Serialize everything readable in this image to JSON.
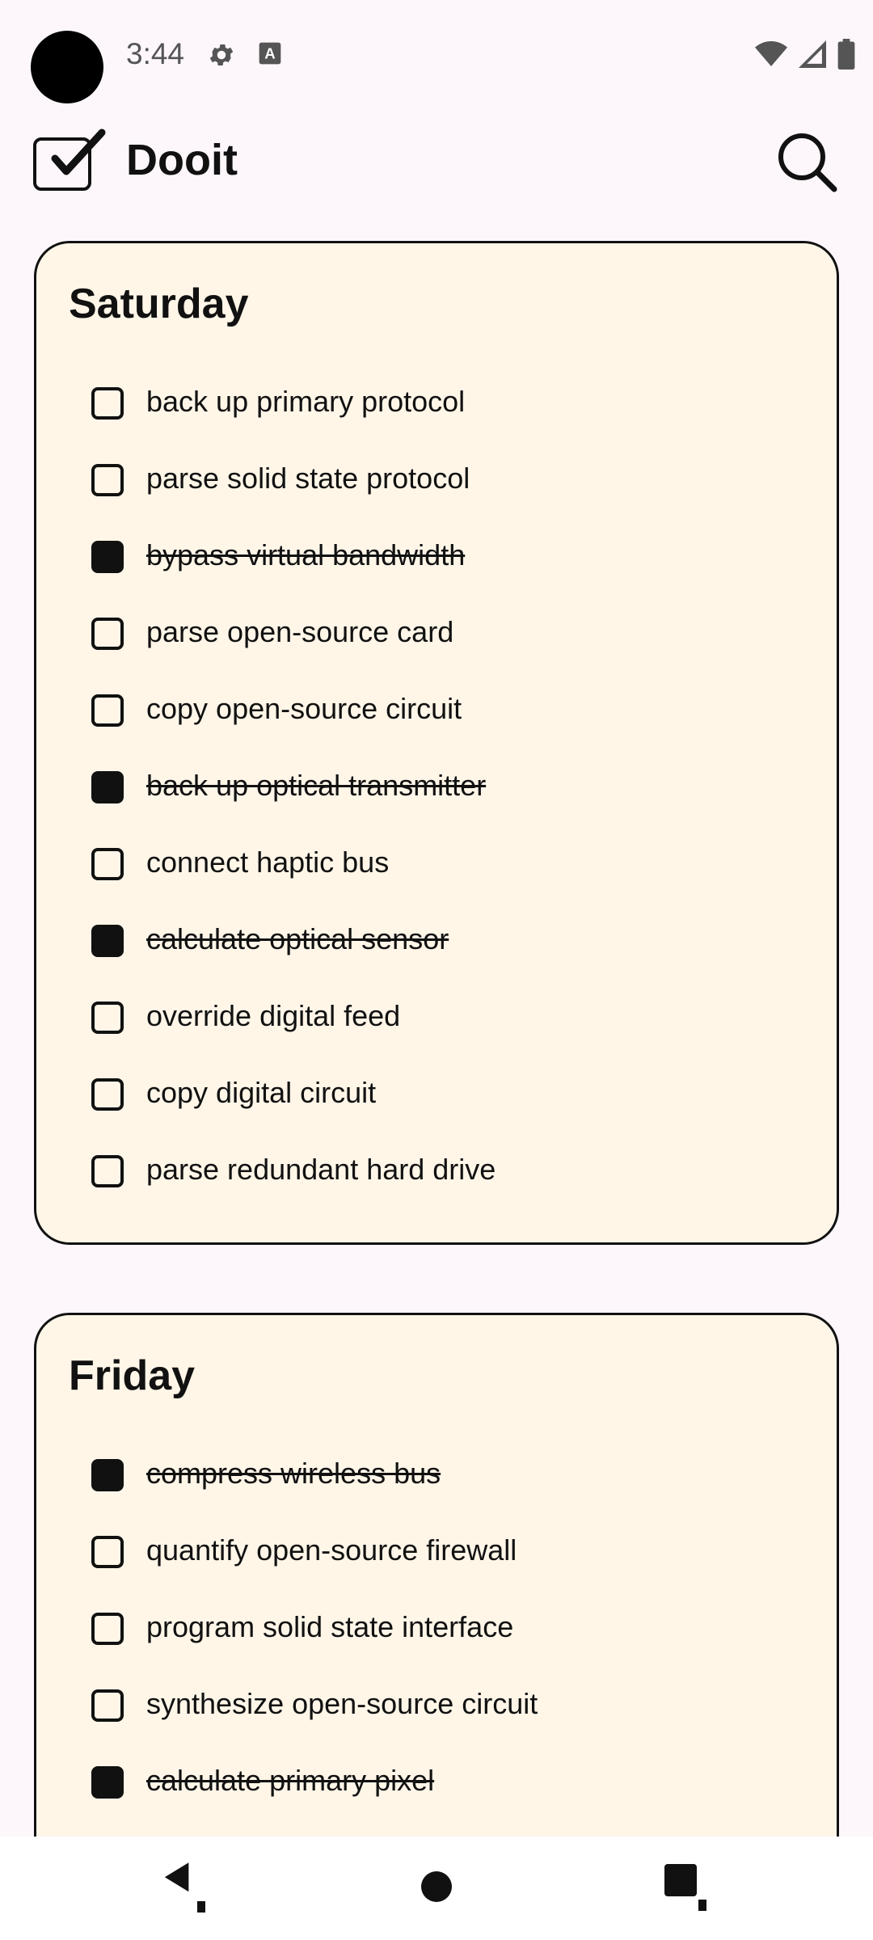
{
  "status_bar": {
    "time": "3:44",
    "icons": [
      "gear-icon",
      "keyboard-a-icon",
      "wifi-icon",
      "signal-icon",
      "battery-icon"
    ]
  },
  "app_bar": {
    "title": "Dooit",
    "logo_icon": "checkbox-logo-icon",
    "search_icon": "search-icon"
  },
  "colors": {
    "background": "#FDF7FC",
    "card_background": "#FFF6E8",
    "accent": "#111111"
  },
  "days": [
    {
      "title": "Saturday",
      "tasks": [
        {
          "label": "back up primary protocol",
          "done": false
        },
        {
          "label": "parse solid state protocol",
          "done": false
        },
        {
          "label": "bypass virtual bandwidth",
          "done": true
        },
        {
          "label": "parse open-source card",
          "done": false
        },
        {
          "label": "copy open-source circuit",
          "done": false
        },
        {
          "label": "back up optical transmitter",
          "done": true
        },
        {
          "label": "connect haptic bus",
          "done": false
        },
        {
          "label": "calculate optical sensor",
          "done": true
        },
        {
          "label": "override digital feed",
          "done": false
        },
        {
          "label": "copy digital circuit",
          "done": false
        },
        {
          "label": "parse redundant hard drive",
          "done": false
        }
      ]
    },
    {
      "title": "Friday",
      "tasks": [
        {
          "label": "compress wireless bus",
          "done": true
        },
        {
          "label": "quantify open-source firewall",
          "done": false
        },
        {
          "label": "program solid state interface",
          "done": false
        },
        {
          "label": "synthesize open-source circuit",
          "done": false
        },
        {
          "label": "calculate primary pixel",
          "done": true
        }
      ]
    }
  ],
  "nav_bar": {
    "icons": [
      "back-icon",
      "home-icon",
      "recents-icon"
    ]
  }
}
